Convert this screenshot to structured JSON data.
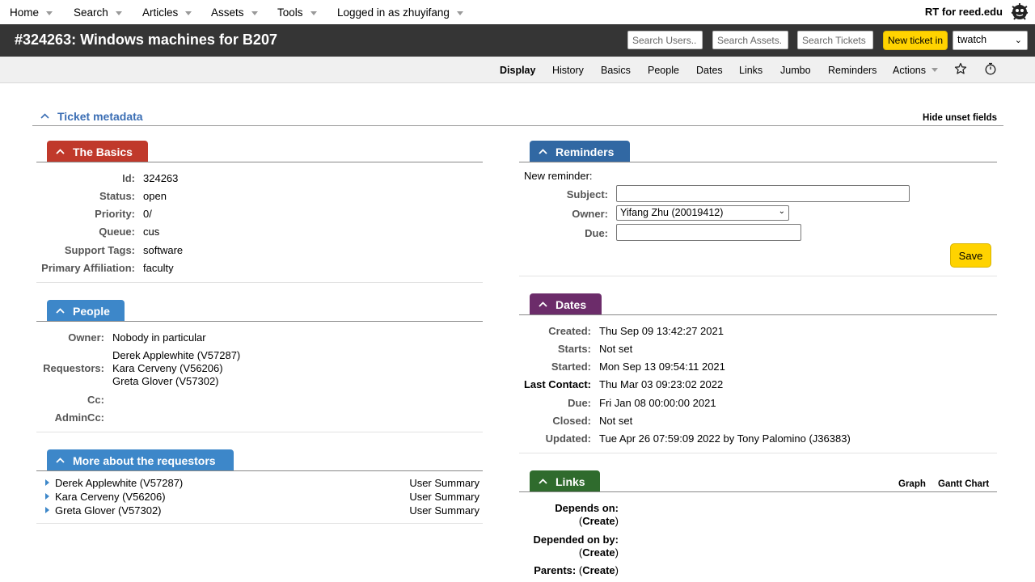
{
  "topnav": {
    "items": [
      "Home",
      "Search",
      "Articles",
      "Assets",
      "Tools",
      "Logged in as zhuyifang"
    ],
    "brand": "RT for reed.edu"
  },
  "titlebar": {
    "title": "#324263: Windows machines for B207",
    "search_users_placeholder": "Search Users..",
    "search_assets_placeholder": "Search Assets.",
    "search_tickets_placeholder": "Search Tickets",
    "new_ticket_label": "New ticket in",
    "queue_selected": "twatch"
  },
  "pagenav": {
    "items": [
      "Display",
      "History",
      "Basics",
      "People",
      "Dates",
      "Links",
      "Jumbo",
      "Reminders",
      "Actions"
    ],
    "active": "Display"
  },
  "metadata": {
    "title": "Ticket metadata",
    "hide_unset": "Hide unset fields"
  },
  "basics": {
    "title": "The Basics",
    "rows": [
      {
        "label": "Id:",
        "value": "324263"
      },
      {
        "label": "Status:",
        "value": "open"
      },
      {
        "label": "Priority:",
        "value": "0/"
      },
      {
        "label": "Queue:",
        "value": "cus"
      },
      {
        "label": "Support Tags:",
        "value": "software"
      },
      {
        "label": "Primary Affiliation:",
        "value": "faculty"
      }
    ]
  },
  "people": {
    "title": "People",
    "owner_label": "Owner:",
    "owner_value": "Nobody in particular",
    "requestors_label": "Requestors:",
    "requestors": [
      "Derek Applewhite (V57287)",
      "Kara Cerveny (V56206)",
      "Greta Glover (V57302)"
    ],
    "cc_label": "Cc:",
    "admincc_label": "AdminCc:"
  },
  "more_requestors": {
    "title": "More about the requestors",
    "rows": [
      {
        "name": "Derek Applewhite (V57287)",
        "link": "User Summary"
      },
      {
        "name": "Kara Cerveny (V56206)",
        "link": "User Summary"
      },
      {
        "name": "Greta Glover (V57302)",
        "link": "User Summary"
      }
    ]
  },
  "reminders": {
    "title": "Reminders",
    "new_reminder": "New reminder:",
    "subject_label": "Subject:",
    "subject_value": "",
    "owner_label": "Owner:",
    "owner_value": "Yifang Zhu (20019412)",
    "due_label": "Due:",
    "due_value": "",
    "save": "Save"
  },
  "dates": {
    "title": "Dates",
    "rows": [
      {
        "label": "Created:",
        "value": "Thu Sep 09 13:42:27 2021"
      },
      {
        "label": "Starts:",
        "value": "Not set"
      },
      {
        "label": "Started:",
        "value": "Mon Sep 13 09:54:11 2021"
      },
      {
        "label": "Last Contact:",
        "value": "Thu Mar 03 09:23:02 2022"
      },
      {
        "label": "Due:",
        "value": "Fri Jan 08 00:00:00 2021"
      },
      {
        "label": "Closed:",
        "value": "Not set"
      },
      {
        "label": "Updated:",
        "value": "Tue Apr 26 07:59:09 2022 by Tony Palomino (J36383)"
      }
    ]
  },
  "links": {
    "title": "Links",
    "graph": "Graph",
    "gantt": "Gantt Chart",
    "depends_on": "Depends on:",
    "depended_on_by": "Depended on by:",
    "parents": "Parents:",
    "create": "Create",
    "paren_open": "(",
    "paren_close": ")"
  }
}
